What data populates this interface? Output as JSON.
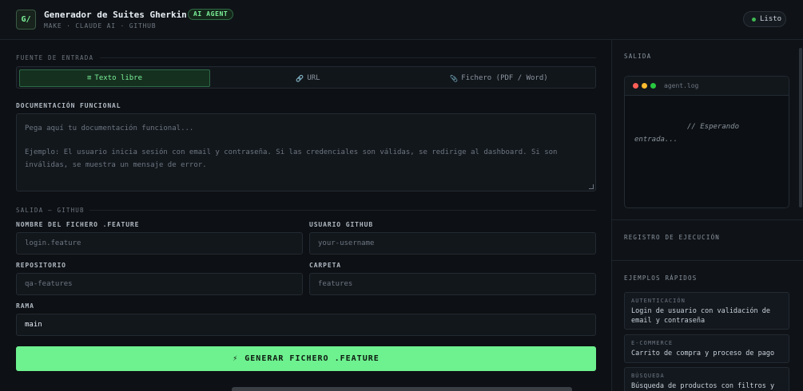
{
  "header": {
    "logo_text": "G/",
    "title": "Generador de Suites Gherkin",
    "badge": "AI AGENT",
    "subtitle": "MAKE · CLAUDE AI · GITHUB",
    "status": "Listo"
  },
  "input_source": {
    "section_label": "FUENTE DE ENTRADA",
    "tabs": [
      {
        "icon": "lines-icon",
        "glyph": "≡",
        "label": "Texto libre",
        "active": true
      },
      {
        "icon": "link-icon",
        "glyph": "🔗",
        "label": "URL",
        "active": false
      },
      {
        "icon": "paperclip-icon",
        "glyph": "📎",
        "label": "Fichero (PDF / Word)",
        "active": false
      }
    ]
  },
  "documentation": {
    "label": "DOCUMENTACIÓN FUNCIONAL",
    "placeholder_line1": "Pega aquí tu documentación funcional...",
    "placeholder_line2": "Ejemplo: El usuario inicia sesión con email y contraseña. Si las credenciales son válidas, se redirige al dashboard. Si son inválidas, se muestra un mensaje de error."
  },
  "github": {
    "section_label": "SALIDA — GITHUB",
    "filename_label": "NOMBRE DEL FICHERO .FEATURE",
    "filename_placeholder": "login.feature",
    "user_label": "USUARIO GITHUB",
    "user_placeholder": "your-username",
    "repo_label": "REPOSITORIO",
    "repo_placeholder": "qa-features",
    "folder_label": "CARPETA",
    "folder_placeholder": "features",
    "branch_label": "RAMA",
    "branch_value": "main"
  },
  "cta": {
    "icon": "⚡",
    "label": "GENERAR FICHERO .FEATURE"
  },
  "sidebar": {
    "output_label": "SALIDA",
    "terminal_name": "agent.log",
    "terminal_text": "// Esperando entrada...",
    "log_label": "REGISTRO DE EJECUCIÓN",
    "examples_label": "EJEMPLOS RÁPIDOS",
    "examples": [
      {
        "category": "AUTENTICACIÓN",
        "text": "Login de usuario con validación de email y contraseña"
      },
      {
        "category": "E-COMMERCE",
        "text": "Carrito de compra y proceso de pago"
      },
      {
        "category": "BÚSQUEDA",
        "text": "Búsqueda de productos con filtros y"
      }
    ]
  },
  "colors": {
    "accent": "#6ef18f",
    "background": "#0d1014",
    "dot_red": "#ff5f57",
    "dot_yellow": "#febc2e",
    "dot_green": "#28c840"
  }
}
